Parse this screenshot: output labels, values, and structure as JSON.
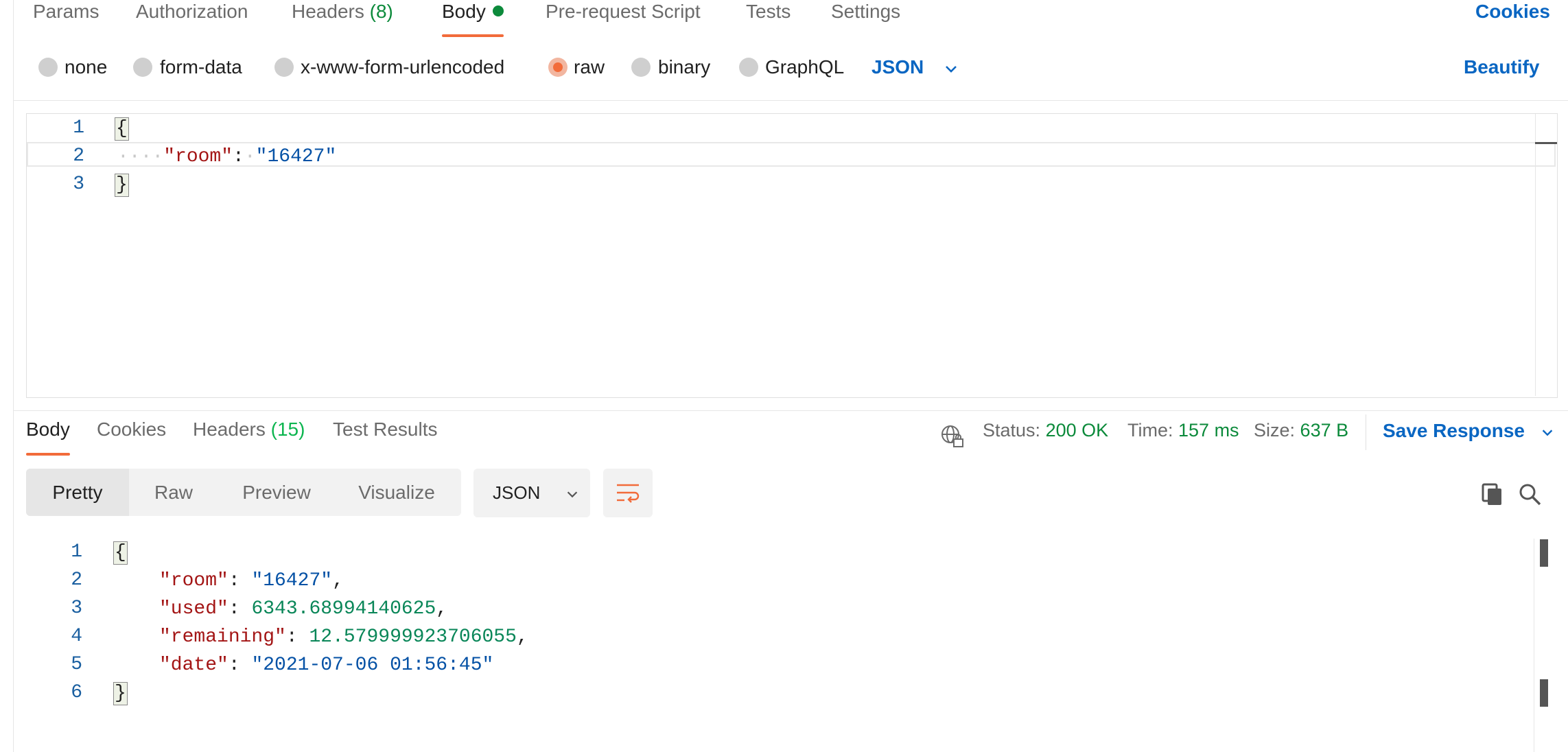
{
  "request_tabs": {
    "params": "Params",
    "authorization": "Authorization",
    "headers_label": "Headers",
    "headers_count": "(8)",
    "body": "Body",
    "pre_request": "Pre-request Script",
    "tests": "Tests",
    "settings": "Settings",
    "cookies": "Cookies"
  },
  "body_types": {
    "none": "none",
    "form_data": "form-data",
    "urlencoded": "x-www-form-urlencoded",
    "raw": "raw",
    "binary": "binary",
    "graphql": "GraphQL",
    "language": "JSON",
    "beautify": "Beautify",
    "selected": "raw"
  },
  "request_editor": {
    "line_numbers": [
      "1",
      "2",
      "3"
    ],
    "open_brace": "{",
    "key": "\"room\"",
    "colon": ":",
    "value": "\"16427\"",
    "close_brace": "}"
  },
  "response_tabs": {
    "body": "Body",
    "cookies": "Cookies",
    "headers_label": "Headers",
    "headers_count": "(15)",
    "test_results": "Test Results"
  },
  "response_status": {
    "status_label": "Status:",
    "status_value": "200 OK",
    "time_label": "Time:",
    "time_value": "157 ms",
    "size_label": "Size:",
    "size_value": "637 B",
    "save_response": "Save Response"
  },
  "response_view": {
    "modes": [
      "Pretty",
      "Raw",
      "Preview",
      "Visualize"
    ],
    "active_mode": "Pretty",
    "format": "JSON"
  },
  "response_body": {
    "line_numbers": [
      "1",
      "2",
      "3",
      "4",
      "5",
      "6"
    ],
    "open_brace": "{",
    "close_brace": "}",
    "room_key": "\"room\"",
    "room_value": "\"16427\"",
    "used_key": "\"used\"",
    "used_value": "6343.68994140625",
    "remaining_key": "\"remaining\"",
    "remaining_value": "12.579999923706055",
    "date_key": "\"date\"",
    "date_value": "\"2021-07-06 01:56:45\""
  },
  "colors": {
    "accent": "#f26b3a",
    "link": "#0a66c2",
    "success": "#0c8a3b"
  }
}
